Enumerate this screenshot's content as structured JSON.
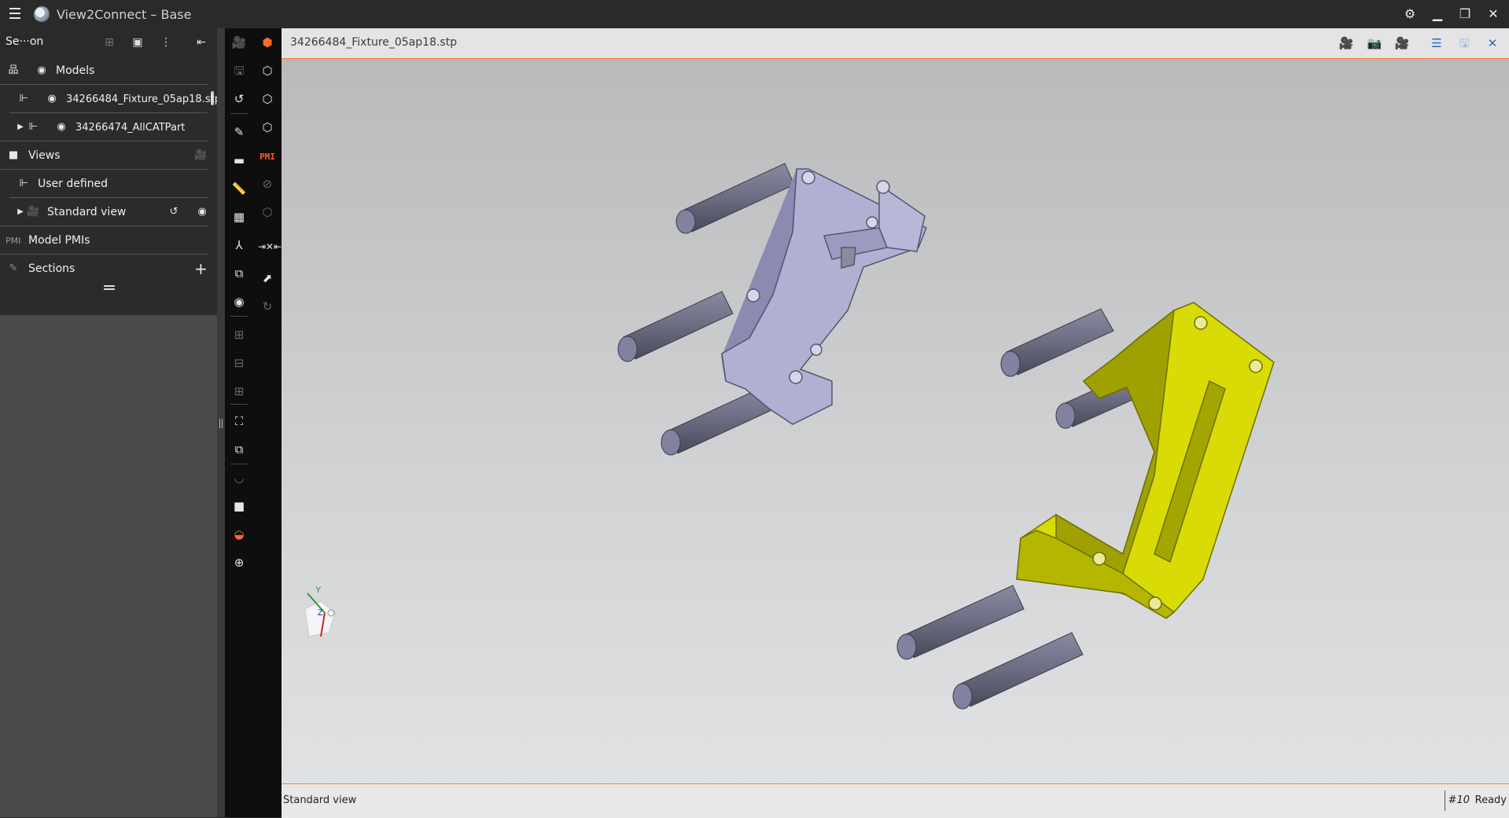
{
  "app": {
    "title": "View2Connect – Base"
  },
  "left_panel": {
    "header_label": "Se···on",
    "tree": {
      "models_label": "Models",
      "model_file": "34266484_Fixture_05ap18.stp",
      "model_part": "34266474_AllCATPart",
      "views_label": "Views",
      "user_defined_label": "User defined",
      "standard_view_label": "Standard view",
      "pmi_badge": "PMI",
      "model_pmis_label": "Model PMIs",
      "sections_label": "Sections"
    }
  },
  "toolbar": {
    "pmi_label": "PMI"
  },
  "viewport": {
    "title": "34266484_Fixture_05ap18.stp",
    "axis": {
      "y": "Y",
      "z": "Z"
    }
  },
  "status": {
    "view_name": "Standard view",
    "count": "#10",
    "state": "Ready"
  },
  "colors": {
    "accent": "#ff6a2b",
    "part_yellow": "#d8da00",
    "part_lavender": "#a9a9c9",
    "pins": "#6f6f86"
  }
}
